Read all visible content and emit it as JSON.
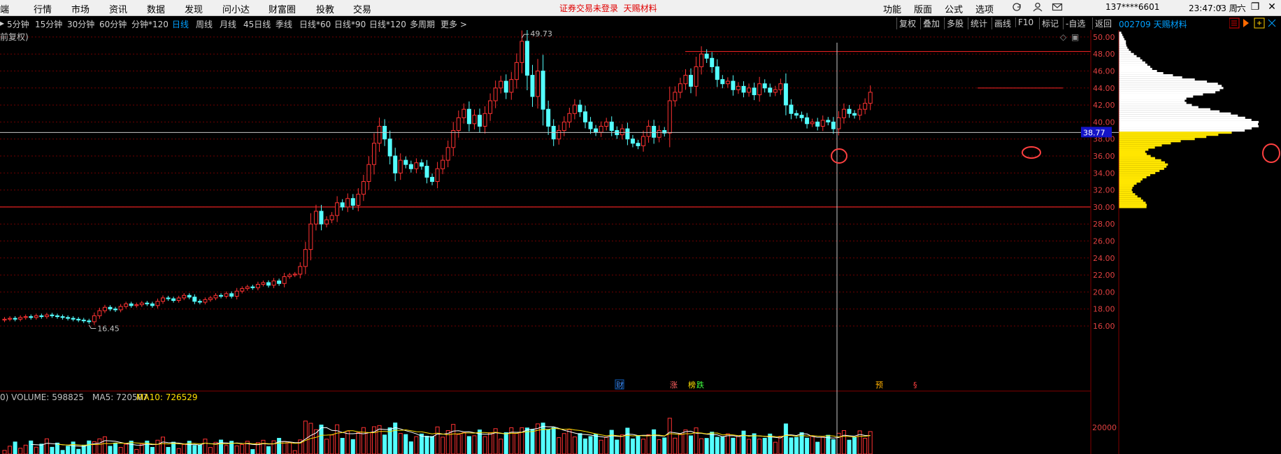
{
  "menubar": {
    "items": [
      "端",
      "行情",
      "市场",
      "资讯",
      "数据",
      "发现",
      "问小达",
      "财富圈",
      "投教",
      "交易"
    ],
    "warning": "证券交易未登录",
    "stock_name": "天赐材料",
    "right_items": [
      "功能",
      "版面",
      "公式",
      "选项"
    ],
    "phone": "137****6601",
    "clock": "23:47:03 周六"
  },
  "periodbar": {
    "periods": [
      "5分钟",
      "15分钟",
      "30分钟",
      "60分钟",
      "分钟*120",
      "日线",
      "周线",
      "月线",
      "45日线",
      "季线",
      "日线*60",
      "日线*90",
      "日线*120",
      "多周期",
      "更多 >"
    ],
    "active": "日线",
    "tools": [
      "复权",
      "叠加",
      "多股",
      "统计",
      "画线",
      "F10",
      "标记",
      "-自选",
      "返回"
    ],
    "stock": "002709 天赐材料"
  },
  "chart_panel": {
    "adjust_label": "前复权)",
    "high_label": "49.73",
    "low_label": "16.45",
    "crosshair_price": "38.77",
    "event_markers": [
      "财",
      "涨",
      "榜",
      "跌",
      "预",
      "§"
    ]
  },
  "volume_panel": {
    "label": "0) VOLUME: 598825",
    "ma5": "MA5: 720507",
    "ma10": "MA10: 726529",
    "axis_label": "20000"
  },
  "chart_data": {
    "type": "candlestick",
    "y_ticks": [
      16,
      18,
      20,
      22,
      24,
      26,
      28,
      30,
      32,
      34,
      36,
      38,
      40,
      42,
      44,
      46,
      48,
      50
    ],
    "y_tick_labels": [
      "16.00",
      "18.00",
      "20.00",
      "22.00",
      "24.00",
      "26.00",
      "28.00",
      "30.00",
      "32.00",
      "34.00",
      "36.00",
      "38.00",
      "40.00",
      "42.00",
      "44.00",
      "46.00",
      "48.00",
      "50.00"
    ],
    "ylim": [
      15,
      51
    ],
    "crosshair_value": 38.77,
    "horizontal_lines": [
      30.0,
      48.3,
      44.0
    ],
    "high": 49.73,
    "low": 16.45,
    "closes": [
      16.8,
      16.9,
      16.8,
      17.0,
      17.1,
      17.0,
      17.2,
      17.1,
      17.3,
      17.2,
      17.1,
      17.0,
      16.9,
      16.8,
      16.7,
      16.6,
      16.5,
      17.2,
      17.8,
      18.2,
      18.0,
      17.9,
      18.3,
      18.6,
      18.4,
      18.5,
      18.7,
      18.6,
      18.4,
      18.9,
      19.3,
      19.2,
      19.0,
      19.3,
      19.6,
      19.4,
      18.9,
      18.8,
      19.1,
      19.3,
      19.6,
      19.5,
      19.8,
      19.5,
      20.1,
      20.4,
      20.6,
      20.5,
      20.9,
      21.1,
      20.8,
      21.3,
      21.0,
      21.8,
      22.0,
      22.1,
      23.0,
      25.0,
      28.0,
      29.5,
      28.0,
      28.5,
      29.0,
      30.5,
      30.0,
      31.0,
      30.2,
      31.5,
      33.0,
      35.0,
      37.5,
      39.5,
      38.0,
      36.0,
      34.0,
      35.5,
      35.0,
      34.5,
      35.2,
      34.8,
      33.5,
      33.0,
      34.5,
      35.5,
      37.0,
      39.0,
      40.5,
      41.5,
      39.8,
      40.8,
      39.5,
      41.0,
      42.5,
      44.0,
      44.8,
      43.5,
      45.0,
      47.0,
      49.5,
      45.5,
      43.0,
      46.0,
      41.5,
      39.5,
      38.0,
      39.0,
      40.0,
      41.0,
      42.0,
      41.2,
      40.0,
      39.2,
      38.8,
      39.5,
      40.0,
      39.0,
      38.5,
      39.2,
      38.0,
      37.5,
      37.2,
      38.3,
      39.5,
      38.2,
      39.0,
      38.7,
      42.5,
      43.5,
      44.5,
      45.5,
      44.2,
      46.5,
      48.0,
      47.5,
      46.5,
      45.0,
      44.5,
      44.8,
      43.8,
      44.2,
      43.5,
      44.0,
      43.2,
      44.5,
      44.0,
      43.5,
      43.8,
      44.5,
      42.0,
      41.0,
      40.8,
      40.5,
      39.8,
      40.0,
      39.5,
      40.2,
      40.0,
      39.2,
      40.5,
      41.5,
      41.0,
      40.8,
      41.5,
      42.2,
      43.5
    ]
  }
}
